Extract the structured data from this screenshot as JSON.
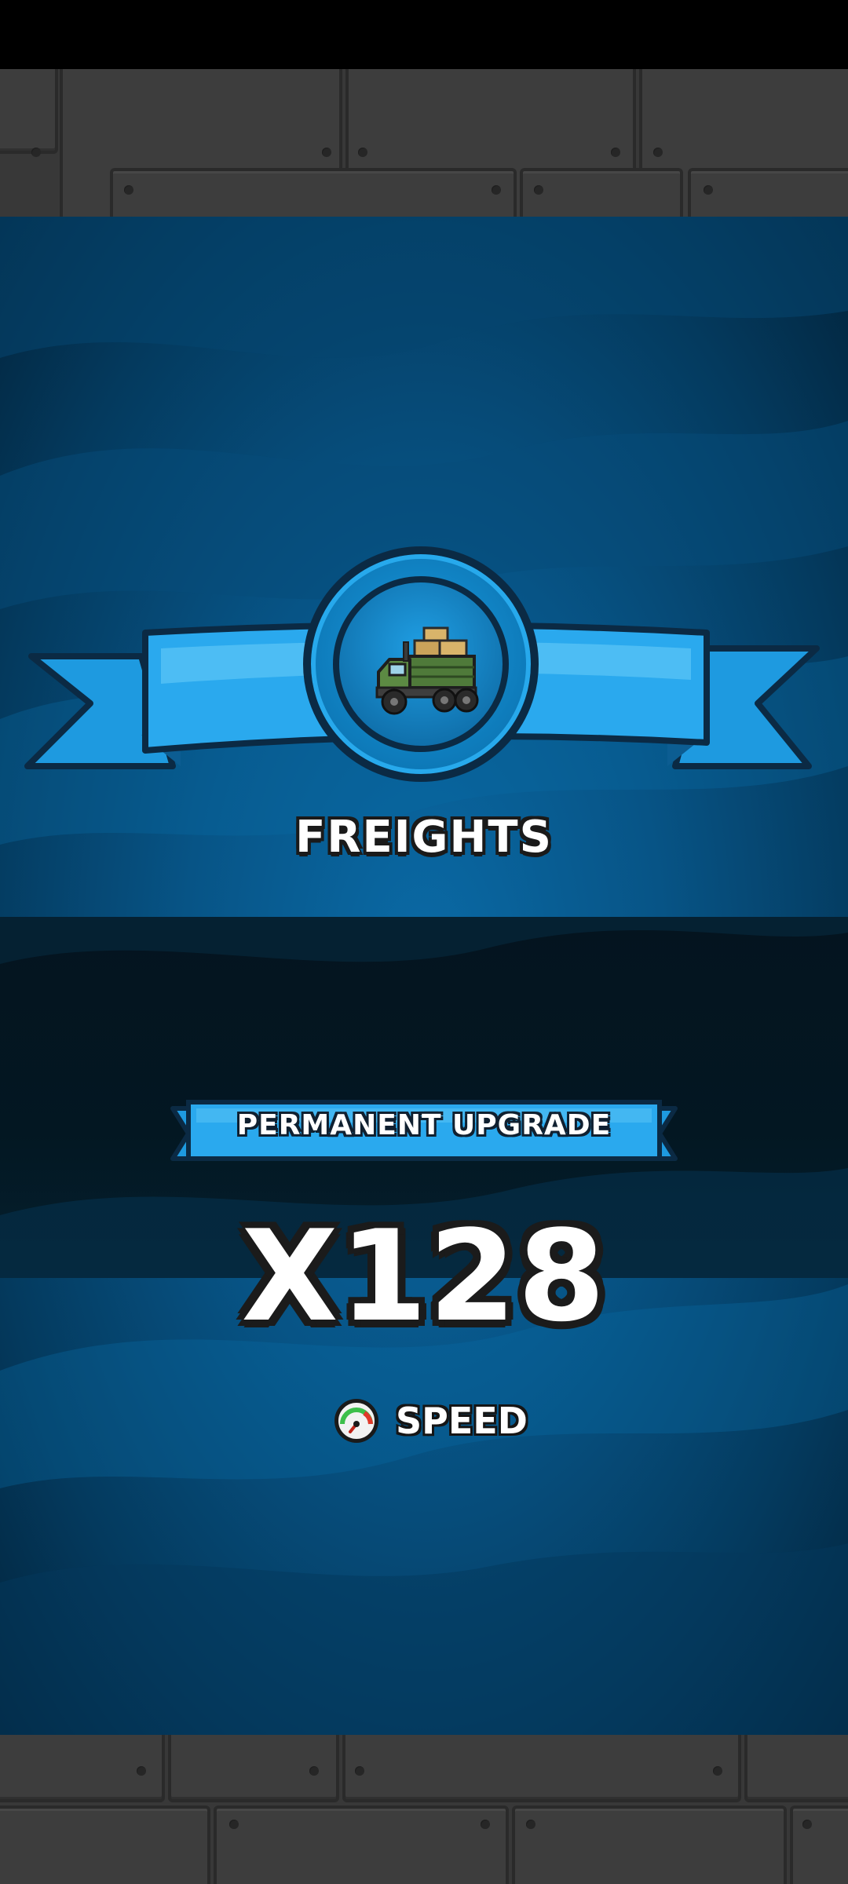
{
  "reward": {
    "name": "FREIGHTS",
    "banner_label": "PERMANENT UPGRADE",
    "multiplier": "X128",
    "stat_label": "SPEED",
    "icon": "freight-truck-icon",
    "stat_icon": "speedometer-icon"
  },
  "colors": {
    "ribbon": "#29a9ec",
    "ribbon_dark": "#0e6fae",
    "background": "#075486",
    "band": "#031722",
    "metal": "#383838"
  }
}
